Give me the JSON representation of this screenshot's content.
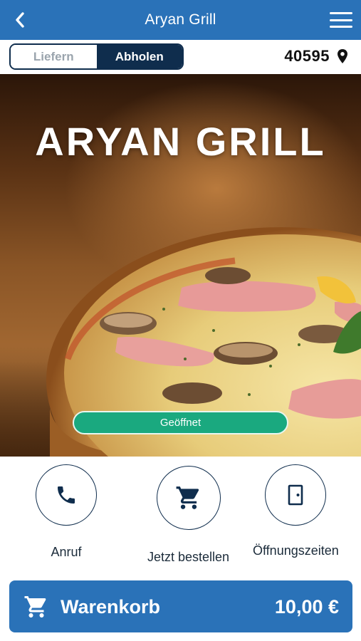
{
  "header": {
    "title": "Aryan Grill"
  },
  "mode_toggle": {
    "delivery_label": "Liefern",
    "pickup_label": "Abholen",
    "selected": "pickup"
  },
  "location": {
    "zip": "40595"
  },
  "hero": {
    "heading": "ARYAN GRILL",
    "status": "Geöffnet"
  },
  "actions": {
    "call_label": "Anruf",
    "order_label": "Jetzt bestellen",
    "hours_label": "Öffnungszeiten"
  },
  "cart": {
    "label": "Warenkorb",
    "total": "10,00 €"
  },
  "colors": {
    "primary": "#2a72b8",
    "dark": "#0f2d4d",
    "open_green": "#1aa97f"
  },
  "icons": {
    "back": "chevron-left-icon",
    "menu": "hamburger-menu-icon",
    "location": "map-pin-icon",
    "call": "phone-icon",
    "order": "cart-icon",
    "hours": "door-icon",
    "cart": "cart-icon"
  }
}
